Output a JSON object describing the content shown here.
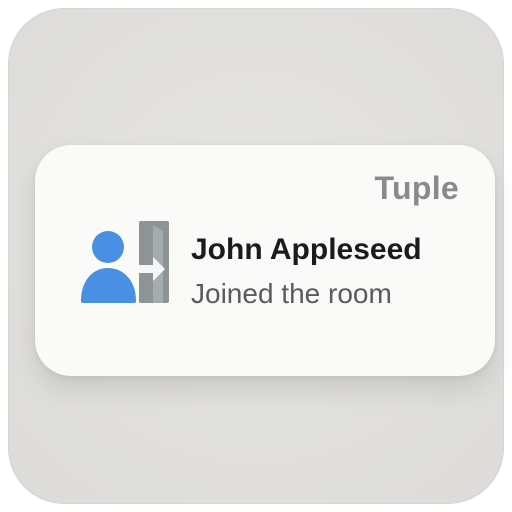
{
  "notification": {
    "app_name": "Tuple",
    "title": "John Appleseed",
    "message": "Joined the room",
    "icon": "user-joined-icon"
  },
  "colors": {
    "backdrop": "#dddcd9",
    "card": "#fafaf9",
    "user_icon": "#4a90e2",
    "door_icon": "#8e9396",
    "app_name": "#8a8a8a",
    "title": "#1b1b1b",
    "message": "#5b5b5b"
  }
}
